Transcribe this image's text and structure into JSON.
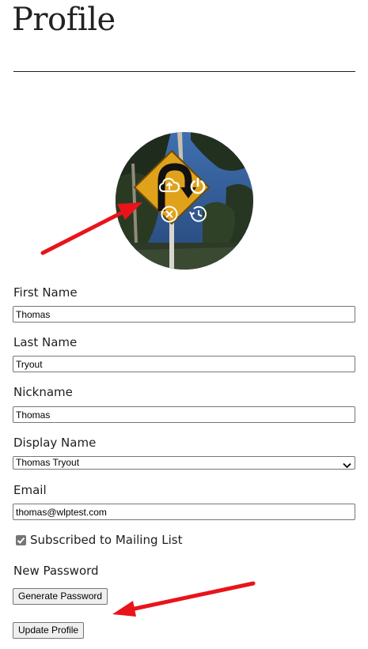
{
  "page": {
    "title": "Profile"
  },
  "avatar": {
    "alt": "Profile photo of a yellow U-turn road sign among trees",
    "controls": [
      "upload-cloud-icon",
      "power-icon",
      "remove-x-icon",
      "history-restore-icon"
    ]
  },
  "form": {
    "first_name": {
      "label": "First Name",
      "value": "Thomas"
    },
    "last_name": {
      "label": "Last Name",
      "value": "Tryout"
    },
    "nickname": {
      "label": "Nickname",
      "value": "Thomas"
    },
    "display_name": {
      "label": "Display Name",
      "selected": "Thomas Tryout"
    },
    "email": {
      "label": "Email",
      "value": "thomas@wlptest.com"
    },
    "mailing_list": {
      "label": "Subscribed to Mailing List",
      "checked": true
    },
    "new_password": {
      "label": "New Password",
      "generate_button": "Generate Password"
    },
    "update_button": "Update Profile"
  },
  "colors": {
    "annotation_arrow": "#e8141a",
    "sign_yellow": "#e0a21a",
    "input_border": "#767676"
  }
}
